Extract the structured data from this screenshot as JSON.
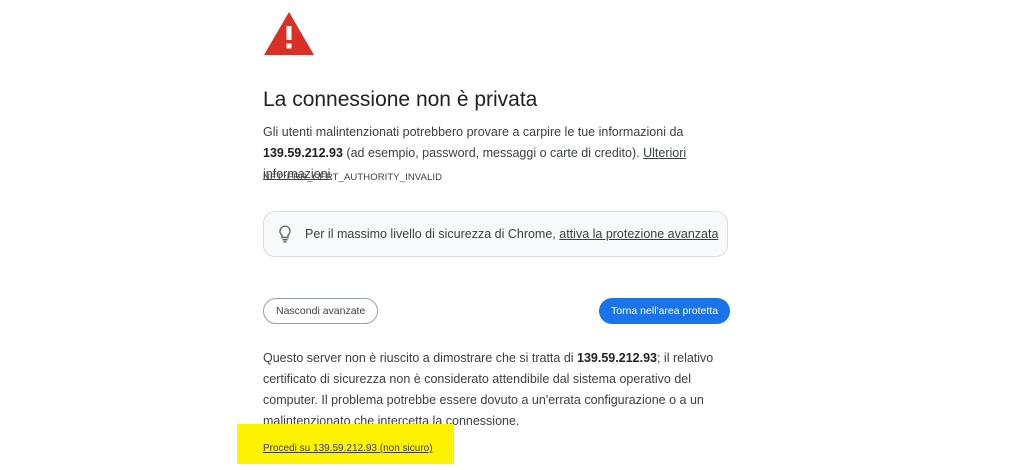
{
  "interstitial": {
    "title": "La connessione non è privata",
    "message_part1": "Gli utenti malintenzionati potrebbero provare a carpire le tue informazioni da",
    "host": "139.59.212.93",
    "message_part2": " (ad esempio, password, messaggi o carte di credito). ",
    "learn_more_link": "Ulteriori informazioni",
    "error_code": "NET::ERR_CERT_AUTHORITY_INVALID",
    "promo_text": "Per il massimo livello di sicurezza di Chrome, ",
    "promo_link": "attiva la protezione avanzata",
    "hide_advanced_label": "Nascondi avanzate",
    "back_to_safety_label": "Torna nell'area protetta",
    "details_part1": "Questo server non è riuscito a dimostrare che si tratta di ",
    "details_host": "139.59.212.93",
    "details_part2": "; il relativo certificato di sicurezza non è considerato attendibile dal sistema operativo del computer. Il problema potrebbe essere dovuto a un'errata configurazione o a un malintenzionato che intercetta la connessione.",
    "proceed_link": "Procedi su 139.59.212.93 (non sicuro)"
  },
  "colors": {
    "warning_red": "#d93025",
    "primary_blue": "#1a73e8",
    "highlight_yellow": "#fff200"
  },
  "icons": {
    "warning": "warning-triangle-icon",
    "promo": "lightbulb-icon"
  }
}
